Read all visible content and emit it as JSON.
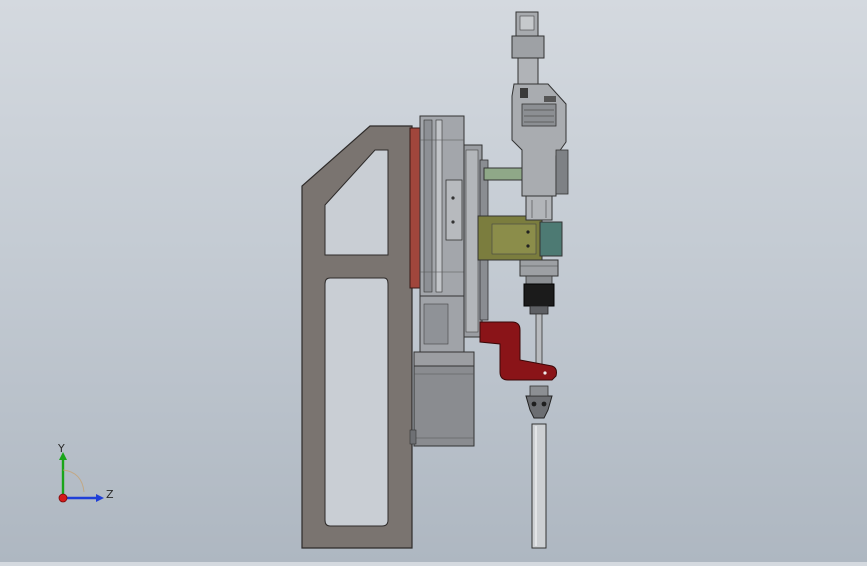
{
  "viewport": {
    "background_top": "#d4d9df",
    "background_bottom": "#aeb7c1"
  },
  "triad": {
    "y_label": "Y",
    "z_label": "Z",
    "y_color": "#1aa51a",
    "z_color": "#1f3fd8",
    "x_color": "#d41a1a"
  },
  "colors": {
    "frame": "#7a7470",
    "rail_plate": "#a0463c",
    "bracket": "#8a1418",
    "motor": "#8a8c90",
    "clamp": "#7b7d3e",
    "clamp_teal": "#4d7a73",
    "green_rod": "#8fa888"
  }
}
